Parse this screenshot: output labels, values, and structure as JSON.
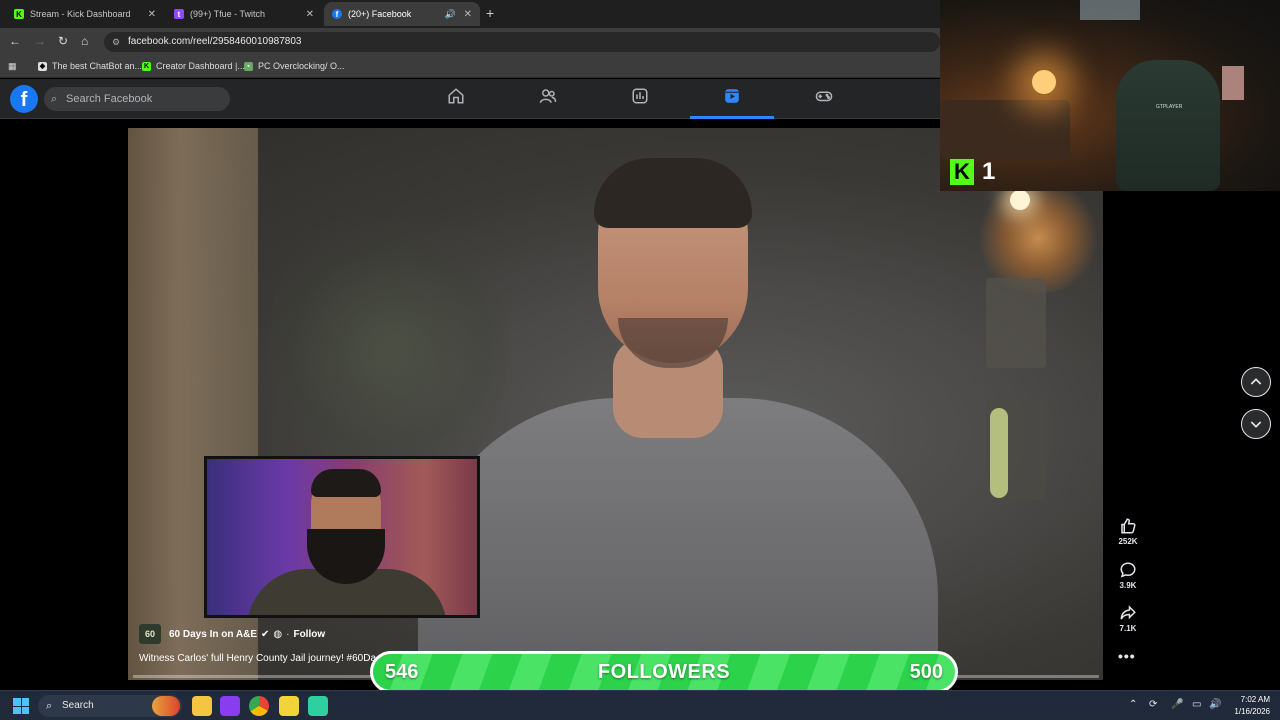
{
  "browser": {
    "tabs": [
      {
        "title": "Stream - Kick Dashboard",
        "icon": "kick-icon",
        "color": "#53fc18"
      },
      {
        "title": "(99+) Tfue - Twitch",
        "icon": "twitch-icon",
        "color": "#9146ff"
      },
      {
        "title": "(20+) Facebook",
        "icon": "facebook-icon",
        "color": "#1877f2",
        "active": true
      }
    ],
    "url": "facebook.com/reel/2958460010987803",
    "bookmarks": [
      {
        "label": "The best ChatBot an...",
        "icon": "chatbot-icon"
      },
      {
        "label": "Creator Dashboard |...",
        "icon": "kick-icon"
      },
      {
        "label": "PC Overclocking/ O...",
        "icon": "web-icon"
      }
    ]
  },
  "facebook": {
    "logo": "f",
    "search_placeholder": "Search Facebook",
    "nav": [
      "home-icon",
      "friends-icon",
      "video-icon",
      "reels-icon",
      "gaming-icon"
    ],
    "active_nav": "reels-icon"
  },
  "reel": {
    "page_name": "60 Days In on A&E",
    "page_logo_text": "60",
    "follow_label": "Follow",
    "caption": "Witness Carlos' full Henry County Jail journey! #60Da",
    "progress": 0.0,
    "actions": [
      {
        "icon": "like-icon",
        "count": "252K"
      },
      {
        "icon": "comment-icon",
        "count": "3.9K"
      },
      {
        "icon": "share-icon",
        "count": "7.1K"
      }
    ]
  },
  "overlay": {
    "followers_current": "546",
    "followers_label": "FOLLOWERS",
    "followers_goal": "500",
    "kick_logo": "K",
    "kick_viewers": "1",
    "chair_label": "GTPLAYER"
  },
  "taskbar": {
    "search_label": "Search",
    "time": "7:02 AM",
    "date": "1/16/2026"
  }
}
